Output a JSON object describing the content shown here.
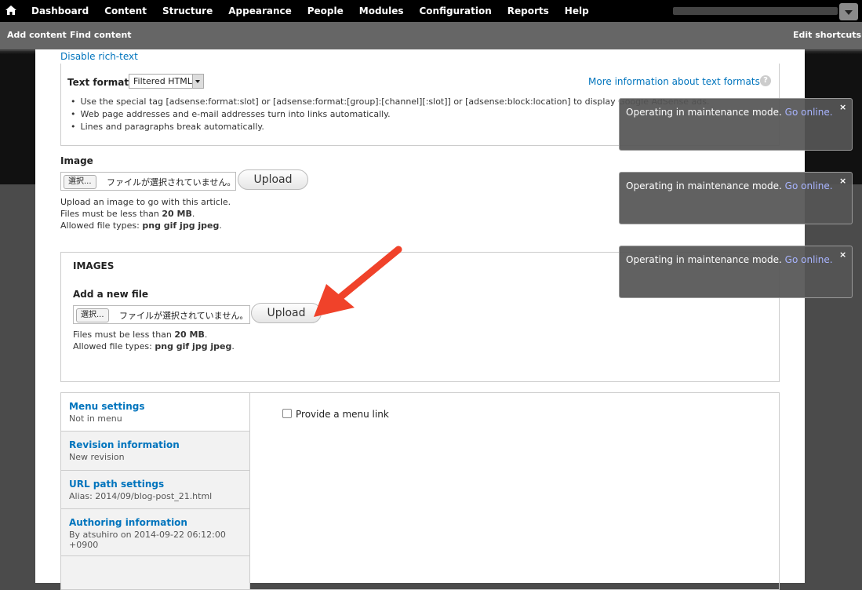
{
  "toolbar": {
    "menu": [
      "Dashboard",
      "Content",
      "Structure",
      "Appearance",
      "People",
      "Modules",
      "Configuration",
      "Reports",
      "Help"
    ]
  },
  "shortcuts": {
    "add_content": "Add content",
    "find_content": "Find content",
    "edit_shortcuts": "Edit shortcuts"
  },
  "body_field": {
    "disable_rich_text": "Disable rich-text",
    "text_format_label": "Text format",
    "text_format_value": "Filtered HTML",
    "more_info": "More information about text formats",
    "help_glyph": "?",
    "tips": [
      "Use the special tag [adsense:format:slot] or [adsense:format:[group]:[channel][:slot]] or [adsense:block:location] to display Google AdSense ads.",
      "Web page addresses and e-mail addresses turn into links automatically.",
      "Lines and paragraphs break automatically."
    ]
  },
  "image_field": {
    "label": "Image",
    "choose": "選択...",
    "no_file": "ファイルが選択されていません。",
    "upload": "Upload",
    "desc1": "Upload an image to go with this article.",
    "desc2_prefix": "Files must be less than ",
    "desc2_value": "20 MB",
    "desc3_prefix": "Allowed file types: ",
    "desc3_value": "png gif jpg jpeg"
  },
  "images_field": {
    "title": "IMAGES",
    "add_new": "Add a new file",
    "choose": "選択...",
    "no_file": "ファイルが選択されていません。",
    "upload": "Upload",
    "desc1_prefix": "Files must be less than ",
    "desc1_value": "20 MB",
    "desc2_prefix": "Allowed file types: ",
    "desc2_value": "png gif jpg jpeg"
  },
  "vertical_tabs": {
    "tabs": [
      {
        "title": "Menu settings",
        "summary": "Not in menu"
      },
      {
        "title": "Revision information",
        "summary": "New revision"
      },
      {
        "title": "URL path settings",
        "summary": "Alias: 2014/09/blog-post_21.html"
      },
      {
        "title": "Authoring information",
        "summary": "By atsuhiro on 2014-09-22 06:12:00 +0900"
      }
    ],
    "menu_link_label": "Provide a menu link"
  },
  "notifications": [
    {
      "message": "Operating in maintenance mode.",
      "link": "Go online.",
      "close": "×"
    },
    {
      "message": "Operating in maintenance mode.",
      "link": "Go online.",
      "close": "×"
    },
    {
      "message": "Operating in maintenance mode.",
      "link": "Go online.",
      "close": "×"
    }
  ],
  "colors": {
    "link": "#0074bd",
    "arrow": "#f0422a",
    "toolbar": "#000000",
    "shortcut_bar": "#666666"
  }
}
